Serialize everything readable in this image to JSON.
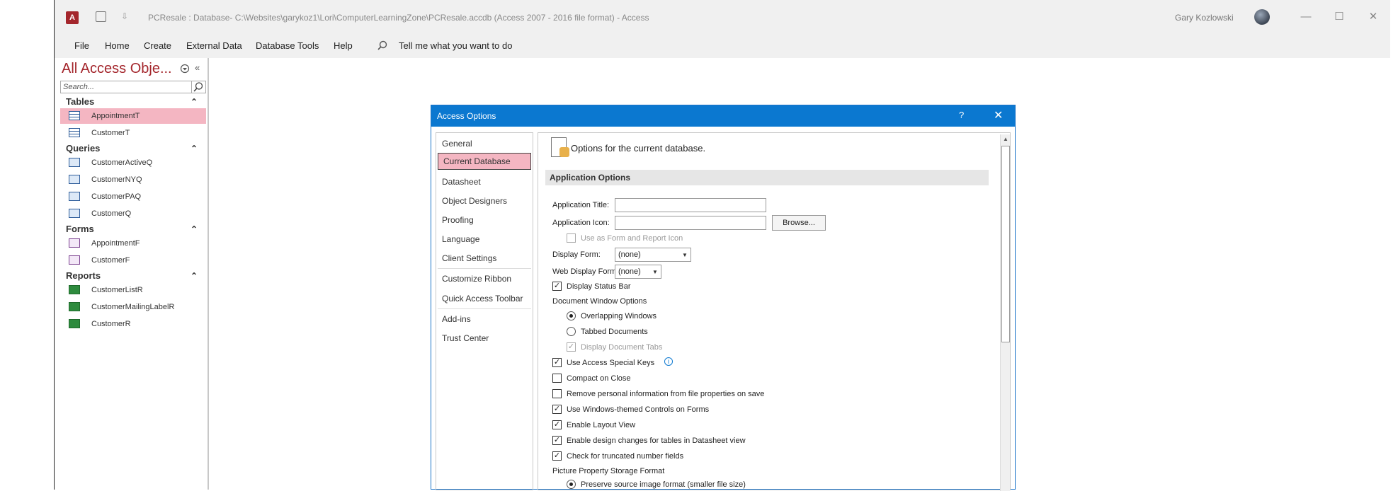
{
  "window": {
    "title": "PCResale : Database- C:\\Websites\\garykoz1\\Lori\\ComputerLearningZone\\PCResale.accdb (Access 2007 - 2016 file format)  -  Access",
    "user": "Gary Kozlowski",
    "controls": {
      "minimize": "—",
      "maximize": "☐",
      "close": "✕"
    },
    "qat_customize": "⇩"
  },
  "ribbon": {
    "tabs": [
      "File",
      "Home",
      "Create",
      "External Data",
      "Database Tools",
      "Help"
    ],
    "tell_me": "Tell me what you want to do"
  },
  "nav": {
    "title": "All Access Obje...",
    "search_placeholder": "Search...",
    "groups": [
      {
        "label": "Tables",
        "icon": "table-icon",
        "items": [
          "AppointmentT",
          "CustomerT"
        ]
      },
      {
        "label": "Queries",
        "icon": "query-icon",
        "items": [
          "CustomerActiveQ",
          "CustomerNYQ",
          "CustomerPAQ",
          "CustomerQ"
        ]
      },
      {
        "label": "Forms",
        "icon": "form-icon",
        "items": [
          "AppointmentF",
          "CustomerF"
        ]
      },
      {
        "label": "Reports",
        "icon": "report-icon",
        "items": [
          "CustomerListR",
          "CustomerMailingLabelR",
          "CustomerR"
        ]
      }
    ],
    "selected_item": "AppointmentT"
  },
  "dialog": {
    "title": "Access Options",
    "help": "?",
    "close": "✕",
    "categories": [
      "General",
      "Current Database",
      "Datasheet",
      "Object Designers",
      "Proofing",
      "Language",
      "Client Settings",
      "Customize Ribbon",
      "Quick Access Toolbar",
      "Add-ins",
      "Trust Center"
    ],
    "selected_category": "Current Database",
    "header": "Options for the current database.",
    "section": "Application Options",
    "fields": {
      "app_title_label": "Application Title:",
      "app_title_value": "",
      "app_icon_label": "Application Icon:",
      "app_icon_value": "",
      "browse": "Browse...",
      "use_as_icon": "Use as Form and Report Icon",
      "display_form_label": "Display Form:",
      "display_form_value": "(none)",
      "web_display_form_label": "Web Display Form:",
      "web_display_form_value": "(none)"
    },
    "options": {
      "display_status_bar": "Display Status Bar",
      "doc_window_options": "Document Window Options",
      "overlapping": "Overlapping Windows",
      "tabbed": "Tabbed Documents",
      "display_doc_tabs": "Display Document Tabs",
      "special_keys": "Use Access Special Keys",
      "compact_on_close": "Compact on Close",
      "remove_personal": "Remove personal information from file properties on save",
      "windows_themed": "Use Windows-themed Controls on Forms",
      "layout_view": "Enable Layout View",
      "design_changes": "Enable design changes for tables in Datasheet view",
      "truncated": "Check for truncated number fields",
      "picture_storage": "Picture Property Storage Format",
      "preserve_source": "Preserve source image format (smaller file size)"
    },
    "check": "✓"
  }
}
